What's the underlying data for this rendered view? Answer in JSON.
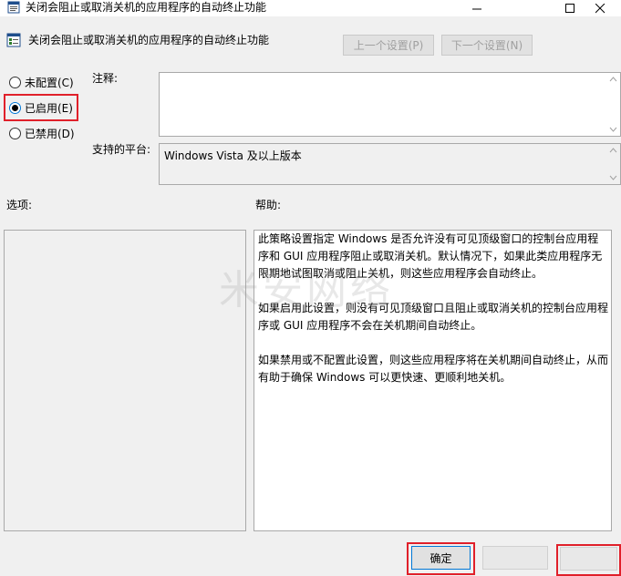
{
  "window": {
    "title": "关闭会阻止或取消关机的应用程序的自动终止功能",
    "minimize_icon": "minimize-icon",
    "maximize_icon": "maximize-icon",
    "close_icon": "close-icon"
  },
  "header": {
    "policy_name": "关闭会阻止或取消关机的应用程序的自动终止功能",
    "prev_setting": "上一个设置(P)",
    "next_setting": "下一个设置(N)"
  },
  "state": {
    "options": [
      {
        "label": "未配置(C)",
        "checked": false
      },
      {
        "label": "已启用(E)",
        "checked": true
      },
      {
        "label": "已禁用(D)",
        "checked": false
      }
    ]
  },
  "comment": {
    "label": "注释:",
    "value": ""
  },
  "platform": {
    "label": "支持的平台:",
    "value": "Windows Vista 及以上版本"
  },
  "options_section": {
    "label": "选项:"
  },
  "help_section": {
    "label": "帮助:",
    "paragraphs": [
      "此策略设置指定 Windows 是否允许没有可见顶级窗口的控制台应用程序和 GUI 应用程序阻止或取消关机。默认情况下，如果此类应用程序无限期地试图取消或阻止关机，则这些应用程序会自动终止。",
      "如果启用此设置，则没有可见顶级窗口且阻止或取消关机的控制台应用程序或 GUI 应用程序不会在关机期间自动终止。",
      "如果禁用或不配置此设置，则这些应用程序将在关机期间自动终止，从而有助于确保 Windows 可以更快速、更顺利地关机。"
    ]
  },
  "watermark": "米安网络",
  "footer": {
    "ok_label": "确定",
    "cancel_label": "",
    "apply_label": ""
  },
  "colors": {
    "highlight": "#e0202a",
    "accent": "#0078d7"
  }
}
